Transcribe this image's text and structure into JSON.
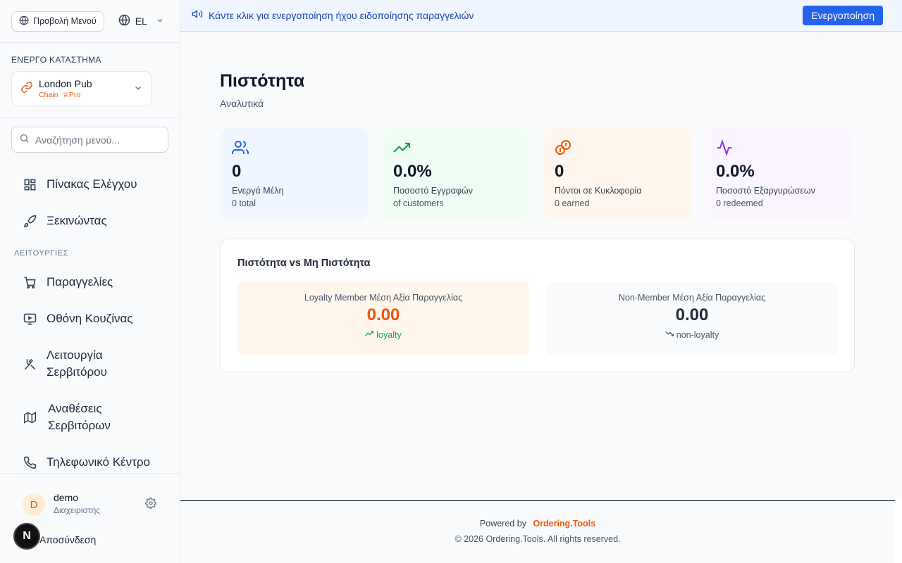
{
  "sidebar": {
    "menu_view_label": "Προβολή Μενού",
    "language": "EL",
    "active_store_heading": "ΕΝΕΡΓΟ ΚΑΤΑΣΤΗΜΑ",
    "store": {
      "name": "London Pub",
      "type": "Chain",
      "plan": "Pro"
    },
    "search_placeholder": "Αναζήτηση μενού...",
    "nav_top": [
      {
        "label": "Πίνακας Ελέγχου",
        "icon": "dashboard-icon"
      },
      {
        "label": "Ξεκινώντας",
        "icon": "rocket-icon"
      }
    ],
    "section_label": "ΛΕΙΤΟΥΡΓΙΕΣ",
    "nav_ops": [
      {
        "label": "Παραγγελίες",
        "icon": "cart-icon"
      },
      {
        "label": "Οθόνη Κουζίνας",
        "icon": "monitor-icon"
      },
      {
        "label": "Λειτουργία Σερβιτόρου",
        "icon": "utensils-icon"
      },
      {
        "label": "Αναθέσεις Σερβιτόρων",
        "icon": "map-icon"
      },
      {
        "label": "Τηλεφωνικό Κέντρο",
        "icon": "phone-icon"
      }
    ],
    "user": {
      "initial": "D",
      "name": "demo",
      "role": "Διαχειριστής"
    },
    "badge_letter": "N",
    "logout_label": "Αποσύνδεση"
  },
  "banner": {
    "text": "Κάντε κλικ για ενεργοποίηση ήχου ειδοποίησης παραγγελιών",
    "button_label": "Ενεργοποίηση"
  },
  "page": {
    "title": "Πιστότητα",
    "subtitle": "Αναλυτικά"
  },
  "stats": [
    {
      "value": "0",
      "label": "Ενεργά Μέλη",
      "sub": "0 total",
      "icon": "users-icon",
      "color": "#2563eb"
    },
    {
      "value": "0.0%",
      "label": "Ποσοστό Εγγραφών",
      "sub": "of customers",
      "icon": "trending-up-icon",
      "color": "#16a34a"
    },
    {
      "value": "0",
      "label": "Πόντοι σε Κυκλοφορία",
      "sub": "0 earned",
      "icon": "coins-icon",
      "color": "#ea580c"
    },
    {
      "value": "0.0%",
      "label": "Ποσοστό Εξαργυρώσεων",
      "sub": "0 redeemed",
      "icon": "activity-icon",
      "color": "#9333ea"
    }
  ],
  "comparison": {
    "title": "Πιστότητα vs Μη Πιστότητα",
    "member": {
      "label": "Loyalty Member Μέση Αξία Παραγγελίας",
      "value": "0.00",
      "tag": "loyalty"
    },
    "non_member": {
      "label": "Non-Member Μέση Αξία Παραγγελίας",
      "value": "0.00",
      "tag": "non-loyalty"
    }
  },
  "footer": {
    "powered_by": "Powered by",
    "brand": "Ordering.Tools",
    "copyright": "© 2026 Ordering.Tools. All rights reserved."
  }
}
